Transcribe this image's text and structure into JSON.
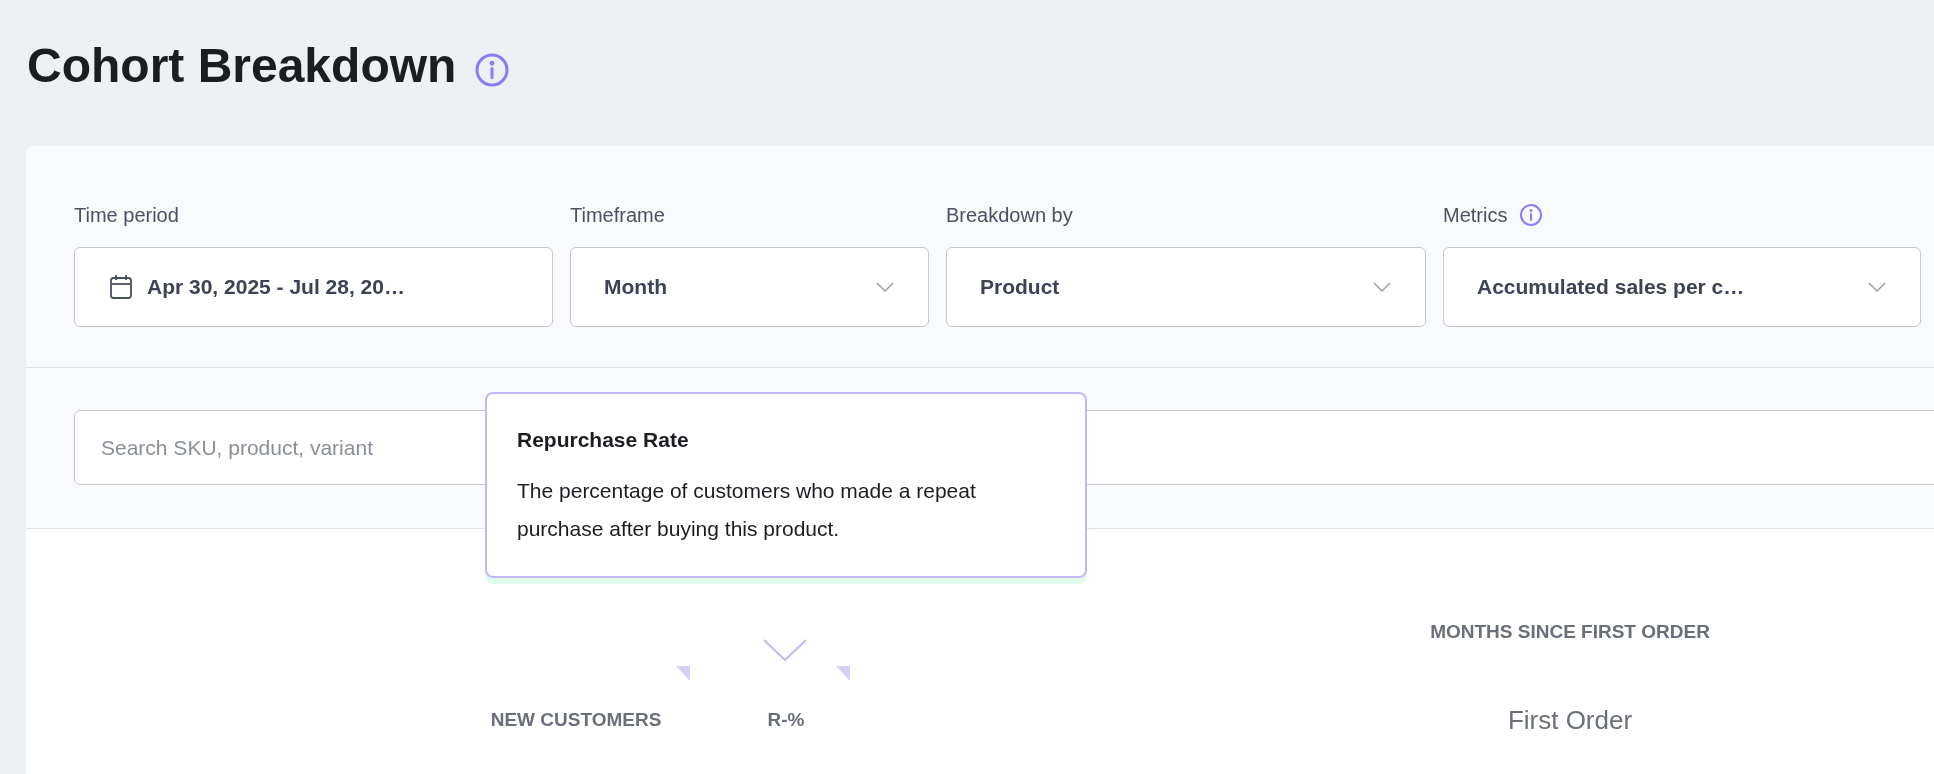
{
  "page": {
    "title": "Cohort Breakdown"
  },
  "filters": [
    {
      "label": "Time period",
      "value": "Apr 30, 2025 - Jul 28, 20…",
      "kind": "date",
      "info": false
    },
    {
      "label": "Timeframe",
      "value": "Month",
      "kind": "select",
      "info": false
    },
    {
      "label": "Breakdown by",
      "value": "Product",
      "kind": "select",
      "info": false
    },
    {
      "label": "Metrics",
      "value": "Accumulated sales per c…",
      "kind": "select",
      "info": true
    }
  ],
  "search": {
    "placeholder": "Search SKU, product, variant"
  },
  "table": {
    "group_header": "MONTHS SINCE FIRST ORDER",
    "columns": [
      {
        "label": "NEW CUSTOMERS",
        "kind": "metric",
        "sortable": true
      },
      {
        "label": "R-%",
        "kind": "metric",
        "sortable": true
      },
      {
        "label": "First Order",
        "kind": "month",
        "sortable": false
      }
    ]
  },
  "tooltip": {
    "title": "Repurchase Rate",
    "text": "The percentage of customers who made a repeat purchase after buying this product."
  }
}
